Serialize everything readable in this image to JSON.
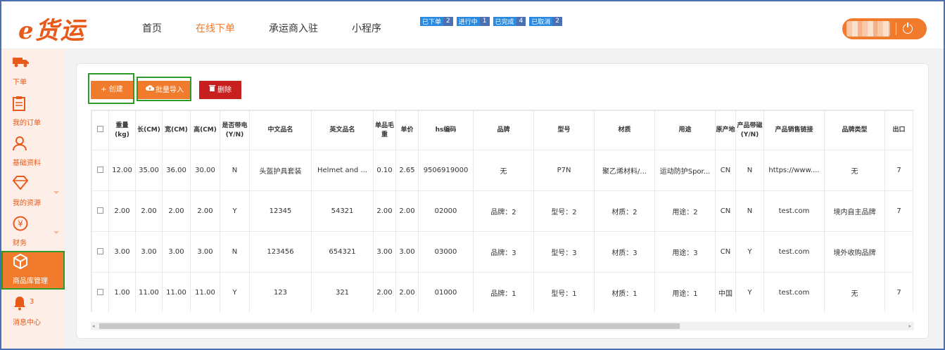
{
  "header": {
    "logo": "e货运",
    "nav": [
      "首页",
      "在线下单",
      "承运商入驻",
      "小程序"
    ],
    "active_nav": 1,
    "badges": [
      {
        "label": "已下单",
        "count": "2"
      },
      {
        "label": "进行中",
        "count": "1"
      },
      {
        "label": "已完成",
        "count": "4"
      },
      {
        "label": "已取消",
        "count": "2"
      }
    ]
  },
  "sidebar": {
    "items": [
      {
        "icon": "truck-icon",
        "label": "下单"
      },
      {
        "icon": "clipboard-icon",
        "label": "我的订单"
      },
      {
        "icon": "users-icon",
        "label": "基础资料"
      },
      {
        "icon": "diamond-icon",
        "label": "我的资源"
      },
      {
        "icon": "yen-icon",
        "label": "财务"
      },
      {
        "icon": "cube-icon",
        "label": "商品库管理"
      },
      {
        "icon": "bell-icon",
        "label": "消息中心",
        "count": "3"
      }
    ]
  },
  "toolbar": {
    "create_label": "+ 创建",
    "import_label": "批量导入",
    "delete_label": "删除"
  },
  "table": {
    "headers": [
      "重量(kg)",
      "长(CM)",
      "宽(CM)",
      "高(CM)",
      "是否带电(Y/N)",
      "中文品名",
      "英文品名",
      "单品毛重",
      "单价",
      "hs编码",
      "品牌",
      "型号",
      "材质",
      "用途",
      "原产地",
      "产品带磁(Y/N)",
      "产品销售链接",
      "品牌类型",
      "出口"
    ],
    "rows": [
      [
        "12.00",
        "35.00",
        "36.00",
        "30.00",
        "N",
        "头盔护具套装",
        "Helmet and ...",
        "0.10",
        "2.65",
        "9506919000",
        "无",
        "P7N",
        "聚乙烯材料/...",
        "运动防护Spor...",
        "CN",
        "N",
        "https://www....",
        "无",
        "7"
      ],
      [
        "2.00",
        "2.00",
        "2.00",
        "2.00",
        "Y",
        "12345",
        "54321",
        "2.00",
        "2.00",
        "02000",
        "品牌：2",
        "型号：2",
        "材质：2",
        "用途：2",
        "CN",
        "N",
        "test.com",
        "境内自主品牌",
        "7"
      ],
      [
        "3.00",
        "3.00",
        "3.00",
        "3.00",
        "N",
        "123456",
        "654321",
        "3.00",
        "3.00",
        "03000",
        "品牌：3",
        "型号：3",
        "材质：3",
        "用途：3",
        "CN",
        "Y",
        "test.com",
        "境外收购品牌",
        ""
      ],
      [
        "1.00",
        "11.00",
        "11.00",
        "11.00",
        "Y",
        "123",
        "321",
        "2.00",
        "2.00",
        "01000",
        "品牌：1",
        "型号：1",
        "材质：1",
        "用途：1",
        "中国",
        "Y",
        "test.com",
        "无",
        "7"
      ]
    ]
  },
  "colors": {
    "accent": "#f07b2c",
    "danger": "#c8201e",
    "highlight": "#2e9a2a",
    "badge": "#2a8ae0"
  }
}
